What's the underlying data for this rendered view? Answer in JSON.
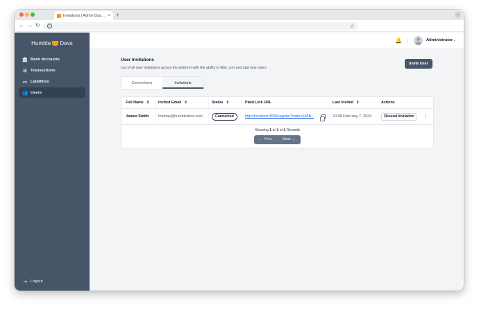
{
  "browser": {
    "tab_title": "Invitations | Admin Dashboard",
    "tab_close": "×",
    "new_tab": "+",
    "tab_menu": "⌄"
  },
  "sidebar": {
    "brand_left": "Humble",
    "brand_right": "Devs",
    "items": [
      {
        "label": "Bank Accounts",
        "icon": "bank-icon",
        "active": false
      },
      {
        "label": "Transactions",
        "icon": "list-icon",
        "active": false
      },
      {
        "label": "Liabilities",
        "icon": "credit-card-icon",
        "active": false
      },
      {
        "label": "Users",
        "icon": "users-icon",
        "active": true
      }
    ],
    "logout": "Logout"
  },
  "header": {
    "user_name": "Administrator"
  },
  "main": {
    "title": "User Invitations",
    "subtitle": "List of all user invitations across the platform with the ability to filter, sort and add new users.",
    "invite_button": "Invite User",
    "tabs": [
      {
        "label": "Connections",
        "active": false
      },
      {
        "label": "Invitations",
        "active": true
      }
    ],
    "table": {
      "columns": [
        "Full Name",
        "Invited Email",
        "Status",
        "Plaid Link URL",
        "Last Invited",
        "Actions"
      ],
      "rows": [
        {
          "full_name": "James Smith",
          "email": "thomas@humbledevs.com",
          "status": "Connected",
          "plaid_link": "http://localhost:3000/register?code=Eb5B...",
          "last_invited": "20:38 February 7, 2024",
          "action": "Resend Invitation"
        }
      ]
    },
    "pagination": {
      "showing_prefix": "Showing",
      "from": "1",
      "to_word": "to",
      "to": "1",
      "of_word": "of",
      "total": "1",
      "records_word": "Records",
      "prev": "Prev",
      "next": "Next"
    }
  },
  "colors": {
    "sidebar_bg": "#475569",
    "accent": "#475569",
    "link": "#2563eb",
    "brand_basket": "#f59e0b"
  }
}
